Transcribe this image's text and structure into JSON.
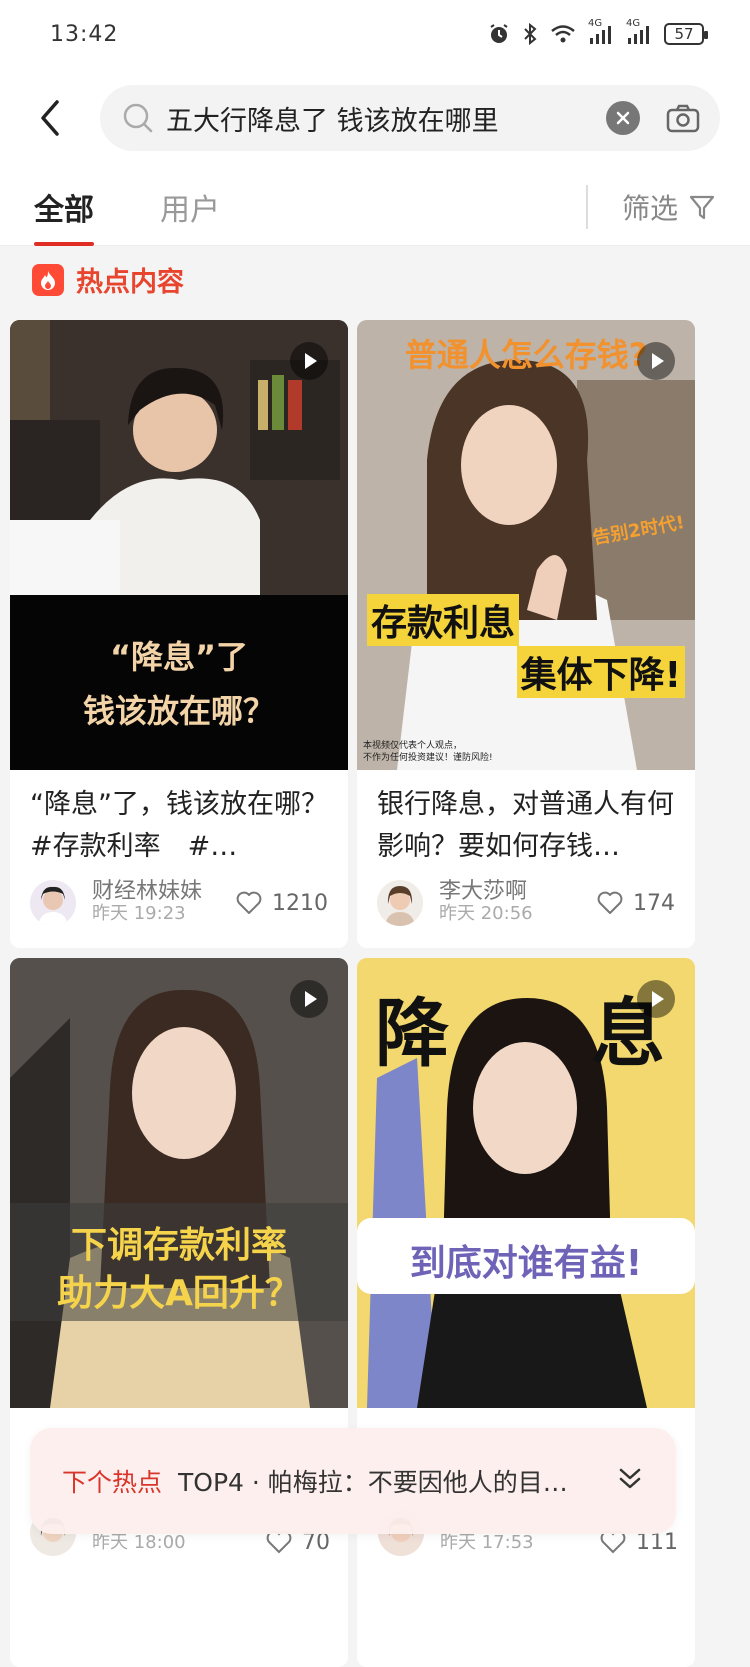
{
  "status_bar": {
    "time": "13:42",
    "network_1": "4G",
    "network_2": "4G",
    "battery": "57",
    "icons": [
      "alarm-icon",
      "bluetooth-icon",
      "wifi-icon",
      "signal-icon",
      "signal-icon",
      "battery-icon"
    ]
  },
  "header": {
    "search_query": "五大行降息了 钱该放在哪里"
  },
  "tabs": [
    {
      "label": "全部",
      "active": true
    },
    {
      "label": "用户",
      "active": false
    }
  ],
  "filter_label": "筛选",
  "section_title": "热点内容",
  "cards": [
    {
      "overlay_line1": "“降息”了",
      "overlay_line2": "钱该放在哪？",
      "title": "“降息”了，钱该放在哪？ #存款利率　#…",
      "author": "财经林妹妹",
      "time": "昨天 19:23",
      "likes": "1210"
    },
    {
      "overlay_top": "普通人怎么存钱?",
      "overlay_tag": "告别2时代!",
      "overlay_mid1": "存款利息",
      "overlay_mid2": "集体下降!",
      "overlay_note1": "本视频仅代表个人观点，",
      "overlay_note2": "不作为任何投资建议！谨防风险!",
      "title": "银行降息，对普通人有何影响？要如何存钱…",
      "author": "李大莎啊",
      "time": "昨天 20:56",
      "likes": "174"
    },
    {
      "overlay_line1": "下调存款利率",
      "overlay_line2": "助力大A回升？",
      "author": "",
      "time": "昨天 18:00",
      "likes": "70"
    },
    {
      "overlay_top1": "降",
      "overlay_top2": "息",
      "overlay_bottom": "到底对谁有益!",
      "author": "",
      "time": "昨天 17:53",
      "likes": "111"
    }
  ],
  "next_hot": {
    "label": "下个热点",
    "text": "TOP4 · 帕梅拉：不要因他人的目…"
  },
  "colors": {
    "accent": "#e02e24",
    "section": "#e8452e"
  }
}
